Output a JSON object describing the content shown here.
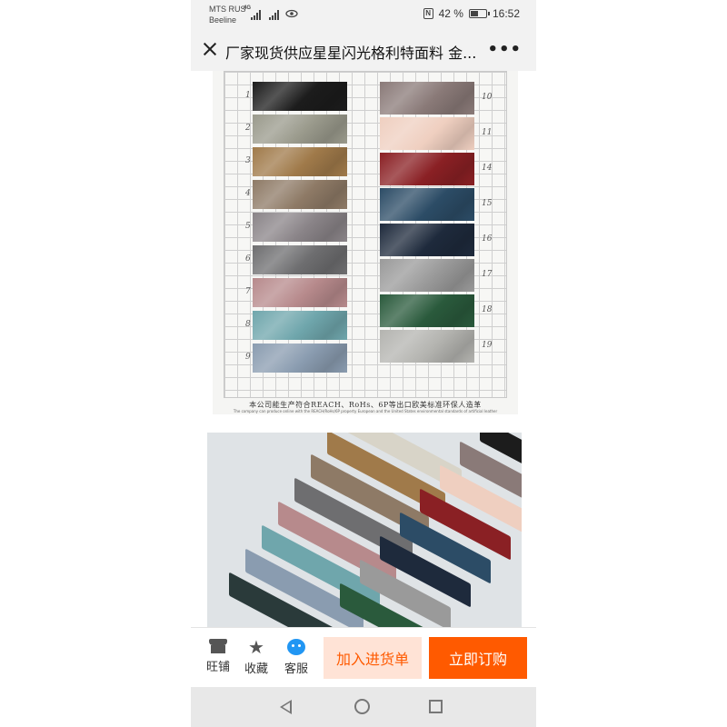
{
  "status_bar": {
    "carrier_line1": "MTS RUS",
    "carrier_line2": "Beeline",
    "network": "4G",
    "battery": "42 %",
    "time": "16:52",
    "nfc": "N"
  },
  "header": {
    "title": "厂家现货供应星星闪光格利特面料 金...",
    "more": "•••"
  },
  "image_1": {
    "notice": "本公司能生产符合REACH、RoHs、6P等出口欧美标准环保人造革",
    "notice_sub": "The company can produce online with the REACH/RoHs/6P property European and the United States environmental standards of artificial leather",
    "left_numbers": [
      "1",
      "2",
      "3",
      "4",
      "5",
      "6",
      "7",
      "8",
      "9"
    ],
    "right_numbers": [
      "10",
      "11",
      "14",
      "15",
      "16",
      "17",
      "18",
      "19"
    ],
    "left_colors": [
      "#1c1c1c",
      "#9a9a8c",
      "#a07a4a",
      "#8e7a66",
      "#8a8488",
      "#6e6e70",
      "#b78a8c",
      "#6fa6ac",
      "#8a9cb0"
    ],
    "right_colors": [
      "#8a7a78",
      "#efcfc0",
      "#8a2024",
      "#2c4c66",
      "#1e2a3c",
      "#9a9a9a",
      "#2a5a3c",
      "#b4b4b0"
    ]
  },
  "image_2": {
    "left_colors": [
      "#d8d4c8",
      "#a07a4a",
      "#8e7a66",
      "#6e6e70",
      "#b78a8c",
      "#6fa6ac",
      "#8a9cb0",
      "#2a3a3a"
    ],
    "right_colors": [
      "#1c1c1c",
      "#8a7a78",
      "#efcfc0",
      "#8a2024",
      "#2c4c66",
      "#1e2a3c",
      "#9a9a9a",
      "#2a5a3c"
    ]
  },
  "action_bar": {
    "store_label": "旺铺",
    "fav_label": "收藏",
    "service_label": "客服",
    "add_cart_label": "加入进货单",
    "buy_label": "立即订购"
  }
}
